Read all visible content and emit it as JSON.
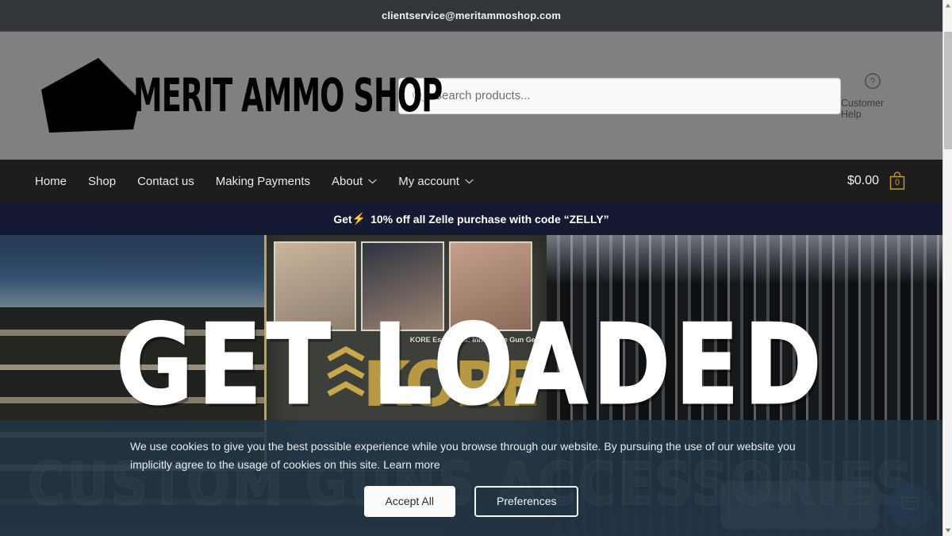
{
  "topbar": {
    "email": "clientservice@meritammoshop.com"
  },
  "masthead": {
    "brand_name": "MERIT AMMO SHOP",
    "logo_icon": "pentagon-logo-icon",
    "search": {
      "placeholder": "Search products...",
      "value": "",
      "icon": "search-icon"
    },
    "help": {
      "icon": "question-circle-icon",
      "label": "Customer Help"
    }
  },
  "nav": {
    "items": [
      {
        "label": "Home",
        "has_dropdown": false
      },
      {
        "label": "Shop",
        "has_dropdown": false
      },
      {
        "label": "Contact us",
        "has_dropdown": false
      },
      {
        "label": "Making Payments",
        "has_dropdown": false
      },
      {
        "label": "About",
        "has_dropdown": true
      },
      {
        "label": "My account",
        "has_dropdown": true
      }
    ],
    "cart": {
      "total": "$0.00",
      "count": "0",
      "icon": "shopping-bag-icon",
      "accent_color": "#c79a2e"
    }
  },
  "promo": {
    "prefix": "Get",
    "bolt": "⚡",
    "text": "10% off all Zelle purchase with code “ZELLY”",
    "background": "#151a33"
  },
  "hero": {
    "title": "GET LOADED",
    "subtitle": "CUSTOM GUNS ACCESSORIES",
    "photo_caption": "KORE Essentials: Innovative Gun Gear",
    "photo_brand_word": "KORE"
  },
  "chat": {
    "greeting": "Hey there!",
    "prompt": "Need help?",
    "icon": "chat-bubble-icon",
    "accent_color": "#2b6ea8"
  },
  "cookie": {
    "text": "We use cookies to give you the best possible experience while you browse through our website. By pursuing the use of our website you implicitly agree to the usage of cookies on this site. ",
    "link_label": "Learn more",
    "accept_label": "Accept All",
    "preferences_label": "Preferences"
  }
}
